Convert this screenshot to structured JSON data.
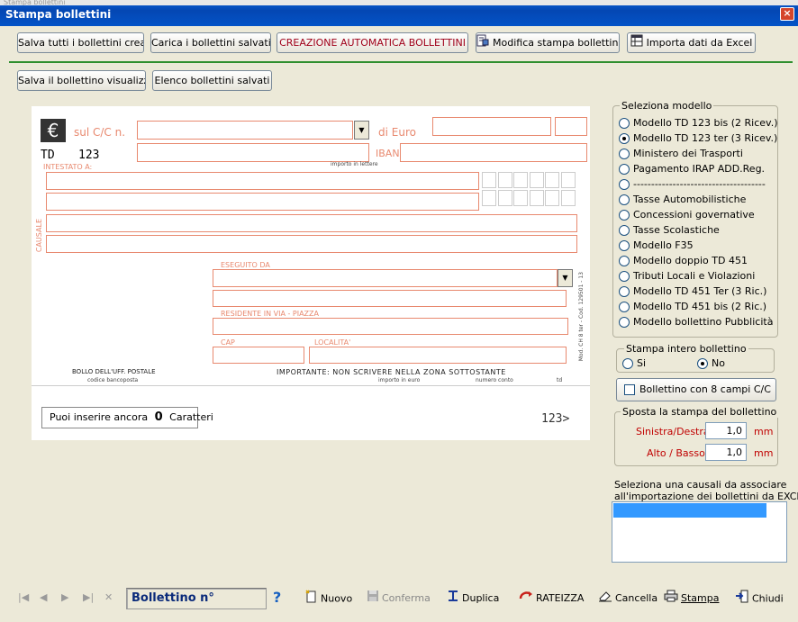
{
  "window": {
    "title": "Stampa bollettini",
    "close": "×",
    "top_strip": "Stampa bollettini"
  },
  "toolbar1": [
    "Salva tutti i bollettini creati",
    "Carica i bollettini salvati",
    "CREAZIONE AUTOMATICA BOLLETTINI",
    "Modifica stampa bollettino",
    "Importa dati da Excel"
  ],
  "toolbar2": [
    "Salva il bollettino visualizzato",
    "Elenco bollettini salvati"
  ],
  "slip": {
    "euro_symbol": "€",
    "sul_cc": "sul C/C n.",
    "di_euro": "di Euro",
    "td": "TD",
    "td_num": "123",
    "iban": "IBAN",
    "importo_lettere": "importo in lettere",
    "intestato": "INTESTATO A:",
    "causale": "CAUSALE",
    "eseguito": "ESEGUITO DA",
    "residente": "RESIDENTE IN VIA - PIAZZA",
    "cap": "CAP",
    "localita": "LOCALITA'",
    "side_code": "Mod. CH 8 ter - Cod. 129501 - 13",
    "bollo": "BOLLO DELL'UFF. POSTALE",
    "codice": "codice bancoposta",
    "importante": "IMPORTANTE: NON SCRIVERE NELLA ZONA SOTTOSTANTE",
    "importo_euro": "importo in euro",
    "numero_conto": "numero conto",
    "td_small": "td",
    "code_line": "123>",
    "chars_prefix": "Puoi inserire ancora",
    "chars_count": "0",
    "chars_suffix": "Caratteri"
  },
  "modello": {
    "title": "Seleziona modello",
    "options": [
      {
        "label": "Modello TD 123 bis (2 Ricev.)",
        "selected": false
      },
      {
        "label": "Modello TD 123 ter (3 Ricev.)",
        "selected": true
      },
      {
        "label": "Ministero dei Trasporti",
        "selected": false
      },
      {
        "label": "Pagamento IRAP ADD.Reg.",
        "selected": false
      },
      {
        "label": "-------------------------------------",
        "selected": false
      },
      {
        "label": "Tasse Automobilistiche",
        "selected": false
      },
      {
        "label": "Concessioni governative",
        "selected": false
      },
      {
        "label": "Tasse Scolastiche",
        "selected": false
      },
      {
        "label": "Modello F35",
        "selected": false
      },
      {
        "label": "Modello doppio TD 451",
        "selected": false
      },
      {
        "label": "Tributi Locali e Violazioni",
        "selected": false
      },
      {
        "label": "Modello TD 451 Ter (3 Ric.)",
        "selected": false
      },
      {
        "label": "Modello TD 451 bis (2 Ric.)",
        "selected": false
      },
      {
        "label": "Modello bollettino Pubblicità",
        "selected": false
      }
    ]
  },
  "intero": {
    "title": "Stampa intero bollettino",
    "si": "Si",
    "no": "No",
    "selected": "No"
  },
  "otto_campi": {
    "label": "Bollettino con 8 campi C/C",
    "checked": false
  },
  "sposta": {
    "title": "Sposta la stampa del bollettino",
    "sx_label": "Sinistra/Destra",
    "sx_value": "1,0",
    "alto_label": "Alto / Basso",
    "alto_value": "1,0",
    "unit": "mm"
  },
  "causali": {
    "label1": "Seleziona una causali da associare",
    "label2": "all'importazione dei bollettini da EXCEL"
  },
  "bottom": {
    "nav": [
      "|◀",
      "◀",
      "▶",
      "▶|",
      "✕"
    ],
    "bollettino_label": "Bollettino n°",
    "help": "?",
    "nuovo": "Nuovo",
    "conferma": "Conferma",
    "duplica": "Duplica",
    "rateizza": "RATEIZZA",
    "cancella": "Cancella",
    "stampa": "Stampa",
    "chiudi": "Chiudi"
  },
  "colors": {
    "slip_orange": "#e8896f",
    "title_blue": "#0447b3",
    "accent_red": "#c00000"
  }
}
